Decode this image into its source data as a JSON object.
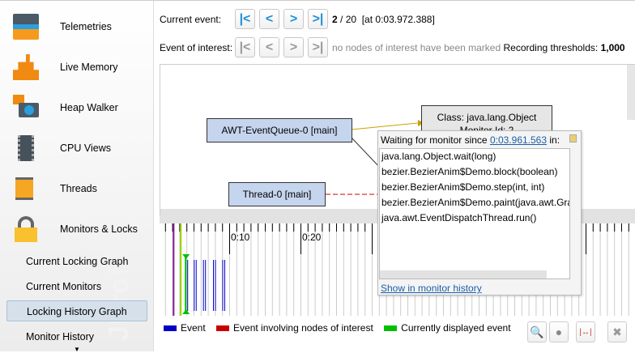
{
  "sidebar": {
    "items": [
      {
        "label": "Telemetries",
        "icon": "telemetries-icon"
      },
      {
        "label": "Live Memory",
        "icon": "live-memory-icon"
      },
      {
        "label": "Heap Walker",
        "icon": "heap-walker-icon"
      },
      {
        "label": "CPU Views",
        "icon": "cpu-views-icon"
      },
      {
        "label": "Threads",
        "icon": "threads-icon"
      },
      {
        "label": "Monitors & Locks",
        "icon": "lock-icon"
      }
    ],
    "subitems": [
      {
        "label": "Current Locking Graph"
      },
      {
        "label": "Current Monitors"
      },
      {
        "label": "Locking History Graph",
        "selected": true
      },
      {
        "label": "Monitor History"
      }
    ],
    "watermark": "JProfiler"
  },
  "toolbar": {
    "current_event_label": "Current event:",
    "current_index": "2",
    "total": "/ 20",
    "timestamp": "[at 0:03.972.388]",
    "interest_label": "Event of interest:",
    "interest_status": "no nodes of interest have been marked",
    "thresholds_label": "Recording thresholds:",
    "thresholds_value": "1,000"
  },
  "graph": {
    "nodes": {
      "awt": "AWT-EventQueue-0 [main]",
      "thread0": "Thread-0 [main]",
      "monitor_line1": "Class: java.lang.Object",
      "monitor_line2": "Monitor Id: 2"
    }
  },
  "popup": {
    "prefix": "Waiting for monitor since",
    "time_link": "0:03.961.563",
    "suffix": "in:",
    "stack": [
      "java.lang.Object.wait(long)",
      "bezier.BezierAnim$Demo.block(boolean)",
      "bezier.BezierAnim$Demo.step(int, int)",
      "bezier.BezierAnim$Demo.paint(java.awt.Graphi",
      "java.awt.EventDispatchThread.run()"
    ],
    "link": "Show in monitor history"
  },
  "timeline": {
    "tick_labels": [
      "0:10",
      "0:20"
    ],
    "events_seconds": [
      4.0,
      5.2,
      6.5,
      7.9,
      9.2
    ],
    "current_event_seconds": 4.0,
    "marker_purple_seconds": 2.2,
    "marker_lime_seconds": 3.2,
    "colors": {
      "event": "#0000c8",
      "interest": "#c80000",
      "current": "#00c000"
    }
  },
  "legend": {
    "event": "Event",
    "interest": "Event involving nodes of interest",
    "current": "Currently displayed event"
  },
  "tools": [
    "zoom-in-icon",
    "zoom-out-icon",
    "fit-icon",
    "close-icon"
  ]
}
